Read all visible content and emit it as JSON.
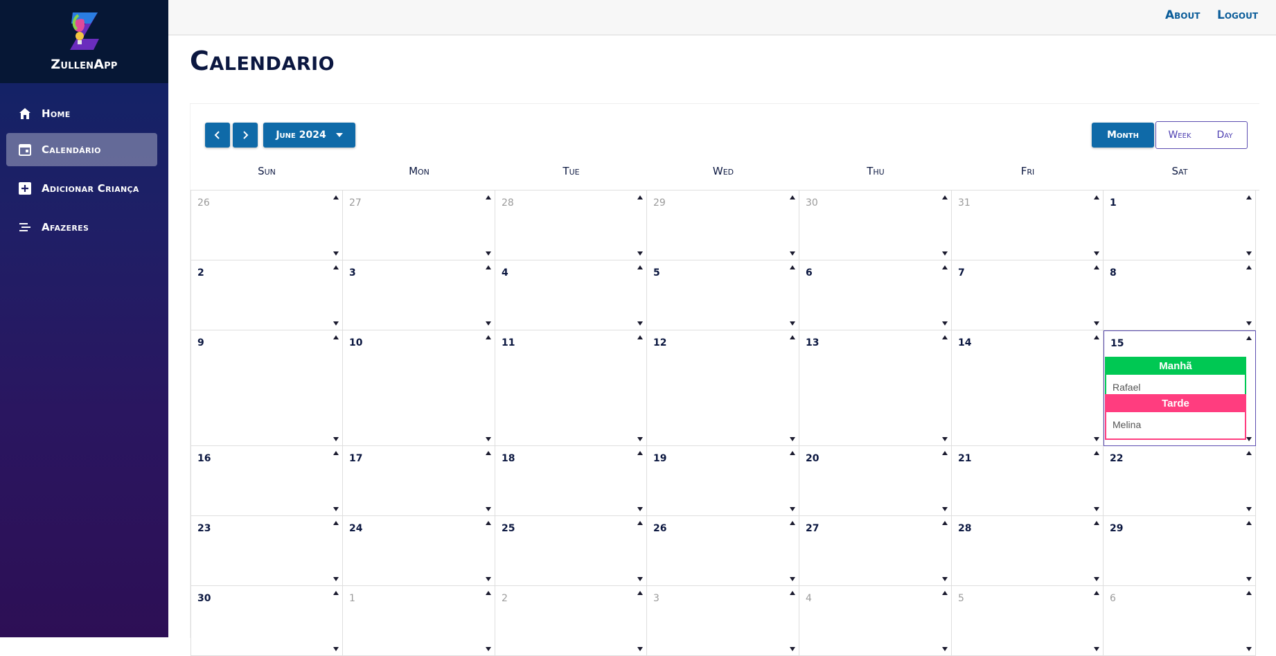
{
  "app": {
    "name": "ZullenApp"
  },
  "sidebar": {
    "items": [
      {
        "label": "Home",
        "icon": "home-icon",
        "active": false
      },
      {
        "label": "Calendário",
        "icon": "calendar-icon",
        "active": true
      },
      {
        "label": "Adicionar Criança",
        "icon": "add-box-icon",
        "active": false
      },
      {
        "label": "Afazeres",
        "icon": "list-icon",
        "active": false
      }
    ]
  },
  "topbar": {
    "about": "About",
    "logout": "Logout"
  },
  "page": {
    "title": "Calendario"
  },
  "calendar": {
    "month_label": "June 2024",
    "views": {
      "month": "Month",
      "week": "Week",
      "day": "Day",
      "selected": "Month"
    },
    "weekdays": [
      "Sun",
      "Mon",
      "Tue",
      "Wed",
      "Thu",
      "Fri",
      "Sat"
    ],
    "weeks": [
      [
        {
          "d": "26",
          "m": true
        },
        {
          "d": "27",
          "m": true
        },
        {
          "d": "28",
          "m": true
        },
        {
          "d": "29",
          "m": true
        },
        {
          "d": "30",
          "m": true
        },
        {
          "d": "31",
          "m": true
        },
        {
          "d": "1",
          "m": false
        }
      ],
      [
        {
          "d": "2",
          "m": false
        },
        {
          "d": "3",
          "m": false
        },
        {
          "d": "4",
          "m": false
        },
        {
          "d": "5",
          "m": false
        },
        {
          "d": "6",
          "m": false
        },
        {
          "d": "7",
          "m": false
        },
        {
          "d": "8",
          "m": false
        }
      ],
      [
        {
          "d": "9",
          "m": false
        },
        {
          "d": "10",
          "m": false
        },
        {
          "d": "11",
          "m": false
        },
        {
          "d": "12",
          "m": false
        },
        {
          "d": "13",
          "m": false
        },
        {
          "d": "14",
          "m": false
        },
        {
          "d": "15",
          "m": false
        }
      ],
      [
        {
          "d": "16",
          "m": false
        },
        {
          "d": "17",
          "m": false
        },
        {
          "d": "18",
          "m": false
        },
        {
          "d": "19",
          "m": false
        },
        {
          "d": "20",
          "m": false
        },
        {
          "d": "21",
          "m": false
        },
        {
          "d": "22",
          "m": false
        }
      ],
      [
        {
          "d": "23",
          "m": false
        },
        {
          "d": "24",
          "m": false
        },
        {
          "d": "25",
          "m": false
        },
        {
          "d": "26",
          "m": false
        },
        {
          "d": "27",
          "m": false
        },
        {
          "d": "28",
          "m": false
        },
        {
          "d": "29",
          "m": false
        }
      ],
      [
        {
          "d": "30",
          "m": false
        },
        {
          "d": "1",
          "m": true
        },
        {
          "d": "2",
          "m": true
        },
        {
          "d": "3",
          "m": true
        },
        {
          "d": "4",
          "m": true
        },
        {
          "d": "5",
          "m": true
        },
        {
          "d": "6",
          "m": true
        }
      ]
    ],
    "events": [
      {
        "day": "15",
        "shift": "Manhã",
        "name": "Rafael",
        "color": "#00c853"
      },
      {
        "day": "15",
        "shift": "Tarde",
        "name": "Melina",
        "color": "#ff3d7f"
      }
    ],
    "selected_day": "15"
  },
  "colors": {
    "accent": "#0f6aa8",
    "sidebar_top": "#061735",
    "morning": "#00c853",
    "afternoon": "#ff3d7f",
    "selected_border": "#5b4cb0"
  }
}
